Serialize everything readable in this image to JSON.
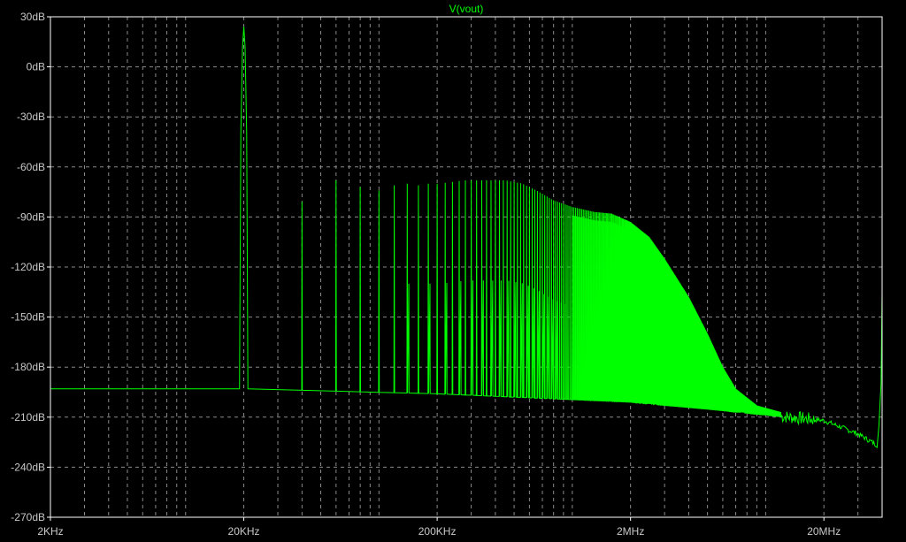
{
  "chart_data": {
    "type": "line",
    "title": "V(vout)",
    "xlabel": "",
    "ylabel": "",
    "x_scale": "log",
    "xlim": [
      2000,
      40000000
    ],
    "ylim": [
      -270,
      30
    ],
    "x_ticks": [
      {
        "value": 2000,
        "label": "2KHz"
      },
      {
        "value": 20000,
        "label": "20KHz"
      },
      {
        "value": 200000,
        "label": "200KHz"
      },
      {
        "value": 2000000,
        "label": "2MHz"
      },
      {
        "value": 20000000,
        "label": "20MHz"
      }
    ],
    "y_ticks": [
      {
        "value": 30,
        "label": "30dB"
      },
      {
        "value": 0,
        "label": "0dB"
      },
      {
        "value": -30,
        "label": "-30dB"
      },
      {
        "value": -60,
        "label": "-60dB"
      },
      {
        "value": -90,
        "label": "-90dB"
      },
      {
        "value": -120,
        "label": "-120dB"
      },
      {
        "value": -150,
        "label": "-150dB"
      },
      {
        "value": -180,
        "label": "-180dB"
      },
      {
        "value": -210,
        "label": "-210dB"
      },
      {
        "value": -240,
        "label": "-240dB"
      },
      {
        "value": -270,
        "label": "-270dB"
      }
    ],
    "grid": true,
    "colors": {
      "background": "#000000",
      "grid": "#8a8a8a",
      "trace": "#00ff00",
      "axis": "#ffffff",
      "text": "#c8c8c8"
    },
    "series": [
      {
        "name": "V(vout)",
        "fundamental": {
          "freq": 20000,
          "db": 24
        },
        "noise_floor": [
          [
            2000,
            -193
          ],
          [
            20000,
            -193
          ],
          [
            200000,
            -196
          ],
          [
            2000000,
            -201
          ],
          [
            6000000,
            -206
          ],
          [
            20000000,
            -212
          ],
          [
            30000000,
            -220
          ],
          [
            38000000,
            -227
          ]
        ],
        "spectral_peaks": [
          [
            20000,
            24
          ],
          [
            40000,
            -81
          ],
          [
            60000,
            -68
          ],
          [
            80000,
            -72
          ],
          [
            100000,
            -74
          ],
          [
            120000,
            -71
          ],
          [
            140000,
            -70
          ],
          [
            160000,
            -71
          ],
          [
            180000,
            -70
          ],
          [
            200000,
            -70
          ],
          [
            240000,
            -69
          ],
          [
            280000,
            -68
          ],
          [
            320000,
            -68
          ],
          [
            380000,
            -68
          ],
          [
            450000,
            -68
          ],
          [
            550000,
            -70
          ],
          [
            650000,
            -74
          ],
          [
            800000,
            -80
          ],
          [
            1000000,
            -84
          ],
          [
            1300000,
            -87
          ],
          [
            1600000,
            -88
          ],
          [
            2000000,
            -93
          ],
          [
            2500000,
            -102
          ],
          [
            3000000,
            -115
          ],
          [
            4000000,
            -138
          ],
          [
            5000000,
            -160
          ],
          [
            6000000,
            -180
          ],
          [
            7000000,
            -193
          ],
          [
            9000000,
            -203
          ],
          [
            12000000,
            -207
          ]
        ],
        "upper_edge_rise": [
          [
            38500000,
            -215
          ],
          [
            39500000,
            -190
          ],
          [
            40000000,
            -135
          ]
        ]
      }
    ]
  }
}
